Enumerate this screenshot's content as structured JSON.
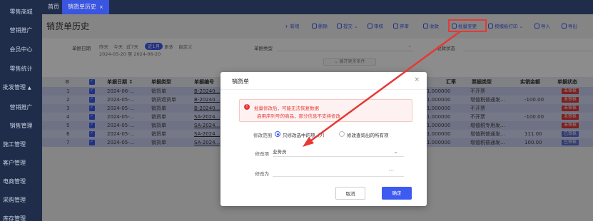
{
  "sidebar": {
    "items": [
      {
        "label": "零售商城"
      },
      {
        "label": "营销推广"
      },
      {
        "label": "会员中心"
      },
      {
        "label": "零售统计"
      },
      {
        "label": "批发管理"
      },
      {
        "label": "营销推广"
      },
      {
        "label": "销售管理"
      },
      {
        "label": "施工管理"
      },
      {
        "label": "客户管理"
      },
      {
        "label": "电商管理"
      },
      {
        "label": "采购管理"
      },
      {
        "label": "库存管理"
      }
    ]
  },
  "tabs": [
    {
      "label": "首页"
    },
    {
      "label": "销货单历史"
    }
  ],
  "page": {
    "title": "销货单历史"
  },
  "toolbar": {
    "items": [
      {
        "label": "新增",
        "icon": "plus-icon"
      },
      {
        "label": "删除",
        "icon": "trash-icon"
      },
      {
        "label": "提交",
        "icon": "submit-icon"
      },
      {
        "label": "审核",
        "icon": "audit-icon"
      },
      {
        "label": "弃审",
        "icon": "unaudit-icon"
      },
      {
        "label": "收款",
        "icon": "receive-icon"
      },
      {
        "label": "批量变更",
        "icon": "batch-change-icon"
      },
      {
        "label": "按模板打印",
        "icon": "print-icon"
      },
      {
        "label": "导入",
        "icon": "import-icon"
      },
      {
        "label": "导出",
        "icon": "export-icon"
      }
    ]
  },
  "filter": {
    "date_label": "单据日期",
    "quick_yesterday": "昨天",
    "quick_today": "今天",
    "quick_last7": "近7天",
    "quick_month": "近1月",
    "quick_more": "更多",
    "quick_custom": "自定义",
    "date_range": "2024-05-20 至 2024-06-20",
    "type_label": "单据类型",
    "receipt_label": "收款状态",
    "more_conditions": "展开更多条件"
  },
  "table": {
    "columns": [
      "",
      "",
      "单据日期 ↕",
      "单据类型",
      "单据编号",
      "汇率",
      "票据类型",
      "实销金额",
      "单据状态"
    ],
    "rows": [
      {
        "no": "1",
        "date": "2024-06-...",
        "type": "销货单",
        "code": "B-20240...",
        "rate": "1.000000",
        "invoice": "不开票",
        "amount": "",
        "status": "未审核"
      },
      {
        "no": "2",
        "date": "2024-05-...",
        "type": "销货退货单",
        "code": "B-20240...",
        "rate": "1.000000",
        "invoice": "增值税普通发...",
        "amount": "-100.00",
        "status": "未审核"
      },
      {
        "no": "3",
        "date": "2024-05-...",
        "type": "销货单",
        "code": "B-20240...",
        "rate": "1.000000",
        "invoice": "不开票",
        "amount": "",
        "status": "未审核"
      },
      {
        "no": "4",
        "date": "2024-05-...",
        "type": "销货单",
        "code": "SA-2024...",
        "rate": "1.000000",
        "invoice": "不开票",
        "amount": "-100.00",
        "status": "未审核"
      },
      {
        "no": "5",
        "date": "2024-05-...",
        "type": "销货单",
        "code": "SA-2024...",
        "rate": "1.000000",
        "invoice": "增值税专用发...",
        "amount": "",
        "status": "未审核"
      },
      {
        "no": "6",
        "date": "2024-05-...",
        "type": "销货单",
        "code": "SA-2024...",
        "rate": "1.000000",
        "invoice": "增值税普通发...",
        "amount": "111.00",
        "status": "已审核"
      },
      {
        "no": "7",
        "date": "2024-05-...",
        "type": "销货单",
        "code": "SA-2024...",
        "rate": "1.000000",
        "invoice": "增值税普通发...",
        "amount": "100.00",
        "status": "已审核"
      }
    ]
  },
  "dialog": {
    "title": "销货单",
    "close": "×",
    "warning_line1": "批量修改后，可能无法恢复数据",
    "warning_line2": "启用序列号的商品，部分信息不支持修改",
    "scope_label": "修改范围",
    "scope_option1": "只修改选中的项（7）",
    "scope_option2": "修改查询出的所有项",
    "field_label": "修改项",
    "field_value": "业务员",
    "to_label": "修改为",
    "to_value": "",
    "cancel": "取消",
    "confirm": "确定"
  },
  "colors": {
    "accent": "#3d5af1",
    "sidebar_bg": "#1f2d4a",
    "warning": "#e53935",
    "status_pending": "#e53935",
    "status_done": "#5b6fd6"
  }
}
